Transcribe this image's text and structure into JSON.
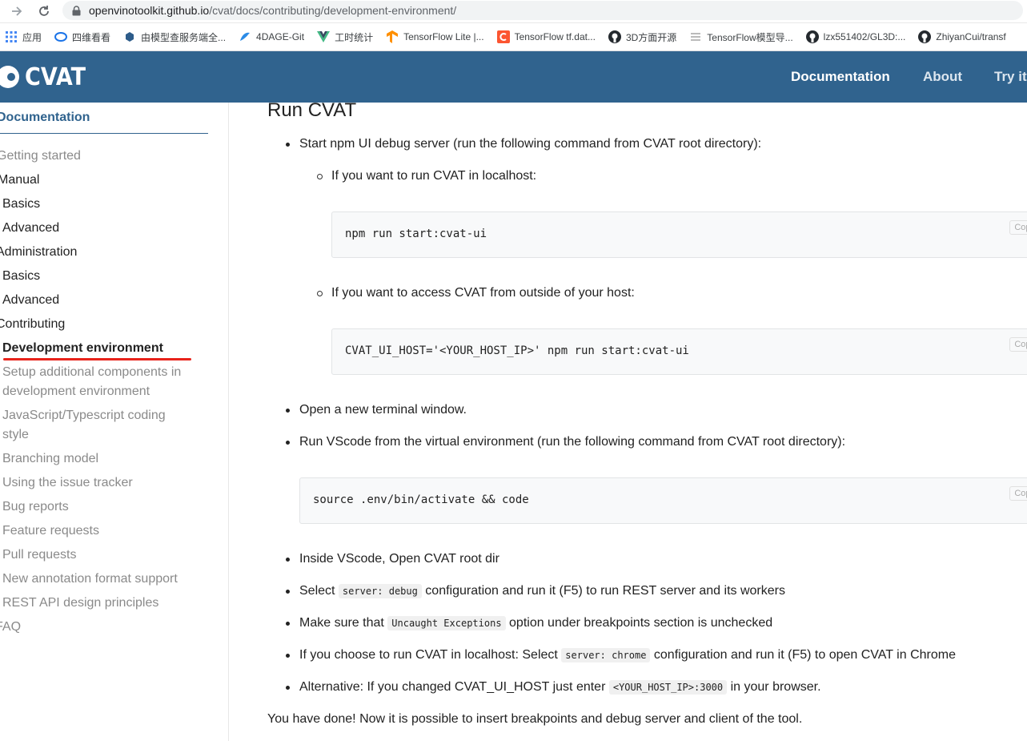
{
  "browser": {
    "url_host": "openvinotoolkit.github.io",
    "url_path": "/cvat/docs/contributing/development-environment/",
    "bookmarks": [
      {
        "label": "应用",
        "icon": "apps-grid-icon"
      },
      {
        "label": "四维看看",
        "icon": "site-favicon-icon"
      },
      {
        "label": "由模型查服务端全...",
        "icon": "site-favicon-icon"
      },
      {
        "label": "4DAGE-Git",
        "icon": "site-favicon-icon"
      },
      {
        "label": "工时统计",
        "icon": "vue-favicon-icon"
      },
      {
        "label": "TensorFlow Lite |...",
        "icon": "tensorflow-icon"
      },
      {
        "label": "TensorFlow tf.dat...",
        "icon": "csdn-icon"
      },
      {
        "label": "3D方面开源",
        "icon": "github-icon"
      },
      {
        "label": "TensorFlow模型导...",
        "icon": "doc-favicon-icon"
      },
      {
        "label": "lzx551402/GL3D:...",
        "icon": "github-icon"
      },
      {
        "label": "ZhiyanCui/transf",
        "icon": "github-icon"
      }
    ]
  },
  "site": {
    "logo_text": "CVAT",
    "nav": [
      "Documentation",
      "About",
      "Try it"
    ]
  },
  "sidebar": {
    "title": "Documentation",
    "items": [
      "Getting started",
      "Manual",
      "Basics",
      "Advanced",
      "Administration",
      "Basics",
      "Advanced",
      "Contributing",
      "Development environment",
      "Setup additional components in",
      "development environment",
      "JavaScript/Typescript coding",
      "style",
      "Branching model",
      "Using the issue tracker",
      "Bug reports",
      "Feature requests",
      "Pull requests",
      "New annotation format support",
      "REST API design principles",
      "FAQ"
    ]
  },
  "content": {
    "heading": "Run CVAT",
    "b1": "Start npm UI debug server (run the following command from CVAT root directory):",
    "b1a": "If you want to run CVAT in localhost:",
    "code1": "npm run start:cvat-ui",
    "b1b": "If you want to access CVAT from outside of your host:",
    "code2": "CVAT_UI_HOST='<YOUR_HOST_IP>' npm run start:cvat-ui",
    "b2": "Open a new terminal window.",
    "b3": "Run VScode from the virtual environment (run the following command from CVAT root directory):",
    "code3": "source .env/bin/activate && code",
    "b4": "Inside VScode, Open CVAT root dir",
    "b5_pre": "Select",
    "b5_code": "server: debug",
    "b5_post": "configuration and run it (F5) to run REST server and its workers",
    "b6_pre": "Make sure that",
    "b6_code": "Uncaught Exceptions",
    "b6_post": "option under breakpoints section is unchecked",
    "b7_pre": "If you choose to run CVAT in localhost: Select",
    "b7_code": "server: chrome",
    "b7_post": "configuration and run it (F5) to open CVAT in Chrome",
    "b8_pre": "Alternative: If you changed CVAT_UI_HOST just enter",
    "b8_code": "<YOUR_HOST_IP>:3000",
    "b8_post": "in your browser.",
    "footer": "You have done! Now it is possible to insert breakpoints and debug server and client of the tool.",
    "copy_label": "Copy"
  },
  "colors": {
    "header_bg": "#30638e",
    "active_underline": "#e8231b"
  }
}
